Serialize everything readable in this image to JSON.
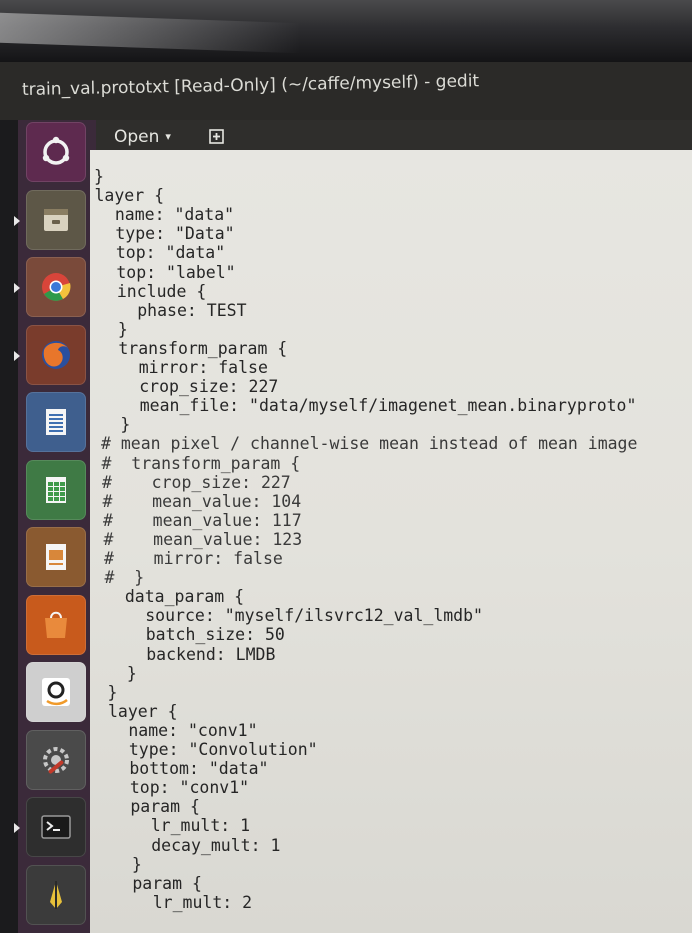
{
  "window": {
    "title": "train_val.prototxt [Read-Only] (~/caffe/myself) - gedit"
  },
  "toolbar": {
    "open_label": "Open",
    "open_caret": "▾",
    "new_document_icon": "new-document-icon"
  },
  "launcher": {
    "items": [
      {
        "name": "ubuntu-dash-icon",
        "color": "#5e2a4f"
      },
      {
        "name": "files-icon",
        "color": "#5d5747"
      },
      {
        "name": "chrome-icon",
        "color": "#7a4a3a"
      },
      {
        "name": "firefox-icon",
        "color": "#7a3c2c"
      },
      {
        "name": "libreoffice-writer-icon",
        "color": "#3f5f8e"
      },
      {
        "name": "libreoffice-calc-icon",
        "color": "#3f7a45"
      },
      {
        "name": "libreoffice-impress-icon",
        "color": "#8a5a30"
      },
      {
        "name": "software-center-icon",
        "color": "#c85a1c"
      },
      {
        "name": "amazon-icon",
        "color": "#cfcfcf"
      },
      {
        "name": "system-settings-icon",
        "color": "#4a4a4a"
      },
      {
        "name": "terminal-icon",
        "color": "#2e2e2e"
      },
      {
        "name": "pen-tool-icon",
        "color": "#3b3b3b"
      }
    ]
  },
  "editor": {
    "lines": [
      "}",
      "layer {",
      "  name: \"data\"",
      "  type: \"Data\"",
      "  top: \"data\"",
      "  top: \"label\"",
      "  include {",
      "    phase: TEST",
      "  }",
      "  transform_param {",
      "    mirror: false",
      "    crop_size: 227",
      "    mean_file: \"data/myself/imagenet_mean.binaryproto\"",
      "  }",
      "# mean pixel / channel-wise mean instead of mean image",
      "#  transform_param {",
      "#    crop_size: 227",
      "#    mean_value: 104",
      "#    mean_value: 117",
      "#    mean_value: 123",
      "#    mirror: false",
      "#  }",
      "  data_param {",
      "    source: \"myself/ilsvrc12_val_lmdb\"",
      "    batch_size: 50",
      "    backend: LMDB",
      "  }",
      "}",
      "layer {",
      "  name: \"conv1\"",
      "  type: \"Convolution\"",
      "  bottom: \"data\"",
      "  top: \"conv1\"",
      "  param {",
      "    lr_mult: 1",
      "    decay_mult: 1",
      "  }",
      "  param {",
      "    lr_mult: 2"
    ]
  }
}
